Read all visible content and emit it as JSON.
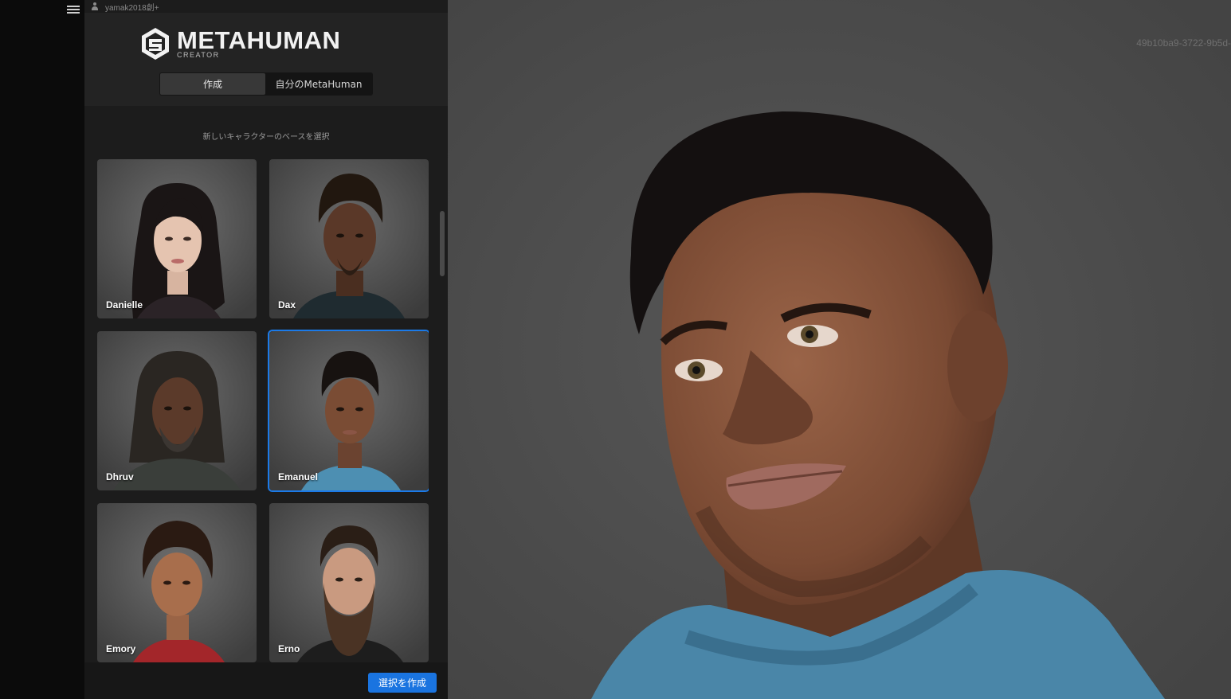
{
  "user": {
    "name": "yamak2018創+"
  },
  "logo": {
    "title": "METAHUMAN",
    "subtitle": "CREATOR"
  },
  "tabs": [
    {
      "label": "作成",
      "active": true
    },
    {
      "label": "自分のMetaHuman",
      "active": false
    }
  ],
  "subtitle": "新しいキャラクターのベースを選択",
  "presets": [
    {
      "name": "Danielle",
      "selected": false
    },
    {
      "name": "Dax",
      "selected": false
    },
    {
      "name": "Dhruv",
      "selected": false
    },
    {
      "name": "Emanuel",
      "selected": true
    },
    {
      "name": "Emory",
      "selected": false
    },
    {
      "name": "Erno",
      "selected": false
    }
  ],
  "footer": {
    "create_label": "選択を作成"
  },
  "viewport": {
    "session_id": "49b10ba9-3722-9b5d-"
  },
  "colors": {
    "accent": "#1a74e0",
    "panel": "#1c1c1c",
    "viewport_bg": "#4b4b4b"
  }
}
